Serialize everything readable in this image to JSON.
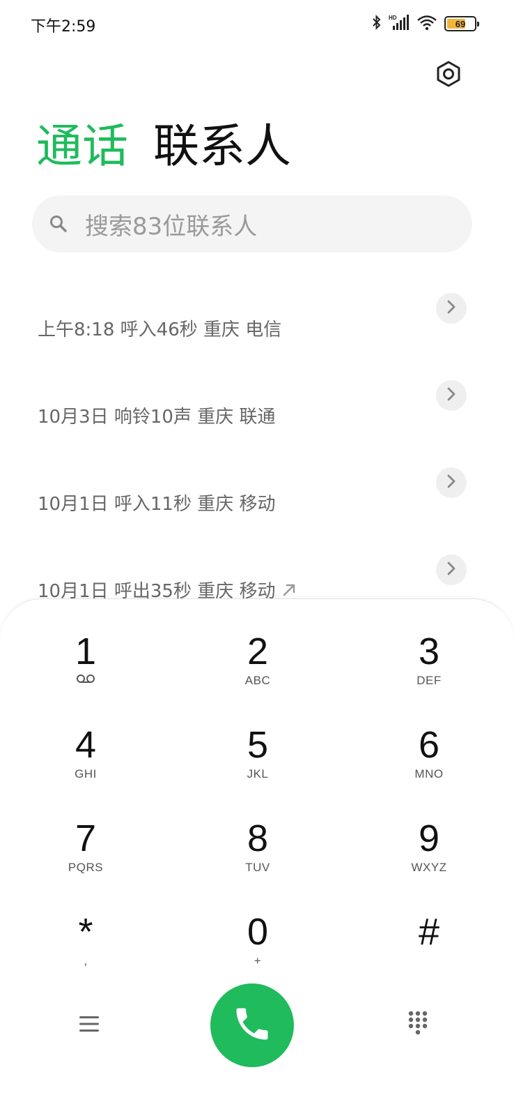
{
  "status_bar": {
    "time": "下午2:59",
    "battery_level": "69",
    "battery_fraction": 0.69,
    "icons": [
      "bluetooth-icon",
      "hd-signal-icon",
      "wifi-icon",
      "battery-icon"
    ]
  },
  "header": {
    "settings_icon": "settings-icon"
  },
  "tabs": [
    {
      "label": "通话",
      "active": true
    },
    {
      "label": "联系人",
      "active": false
    }
  ],
  "search": {
    "placeholder": "搜索83位联系人"
  },
  "call_log": [
    {
      "detail": "上午8:18 呼入46秒 重庆 电信",
      "outgoing": false
    },
    {
      "detail": "10月3日 响铃10声 重庆 联通",
      "outgoing": false
    },
    {
      "detail": "10月1日 呼入11秒 重庆 移动",
      "outgoing": false
    },
    {
      "detail": "10月1日 呼出35秒 重庆 移动",
      "outgoing": true
    }
  ],
  "dialpad": {
    "keys": [
      {
        "digit": "1",
        "letters": ""
      },
      {
        "digit": "2",
        "letters": "ABC"
      },
      {
        "digit": "3",
        "letters": "DEF"
      },
      {
        "digit": "4",
        "letters": "GHI"
      },
      {
        "digit": "5",
        "letters": "JKL"
      },
      {
        "digit": "6",
        "letters": "MNO"
      },
      {
        "digit": "7",
        "letters": "PQRS"
      },
      {
        "digit": "8",
        "letters": "TUV"
      },
      {
        "digit": "9",
        "letters": "WXYZ"
      },
      {
        "digit": "*",
        "letters": ","
      },
      {
        "digit": "0",
        "letters": "+"
      },
      {
        "digit": "#",
        "letters": ""
      }
    ]
  },
  "colors": {
    "accent_green": "#1fbb5c",
    "battery_fill": "#f2b53a"
  }
}
